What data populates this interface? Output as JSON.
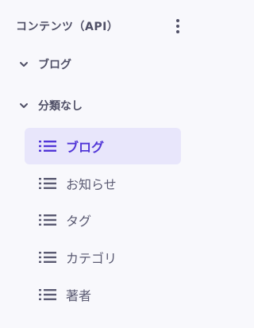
{
  "section": {
    "title": "コンテンツ（API）",
    "more_icon": "more-vertical-icon"
  },
  "groups": [
    {
      "label": "ブログ",
      "expanded": true
    },
    {
      "label": "分類なし",
      "expanded": true
    }
  ],
  "items": [
    {
      "label": "ブログ",
      "icon": "list-icon",
      "active": true
    },
    {
      "label": "お知らせ",
      "icon": "list-icon",
      "active": false
    },
    {
      "label": "タグ",
      "icon": "list-icon",
      "active": false
    },
    {
      "label": "カテゴリ",
      "icon": "list-icon",
      "active": false
    },
    {
      "label": "著者",
      "icon": "list-icon",
      "active": false
    }
  ],
  "colors": {
    "background": "#f8f8fc",
    "text": "#4f4f66",
    "active_background": "#e8e6fb",
    "active_text": "#5136d7"
  }
}
